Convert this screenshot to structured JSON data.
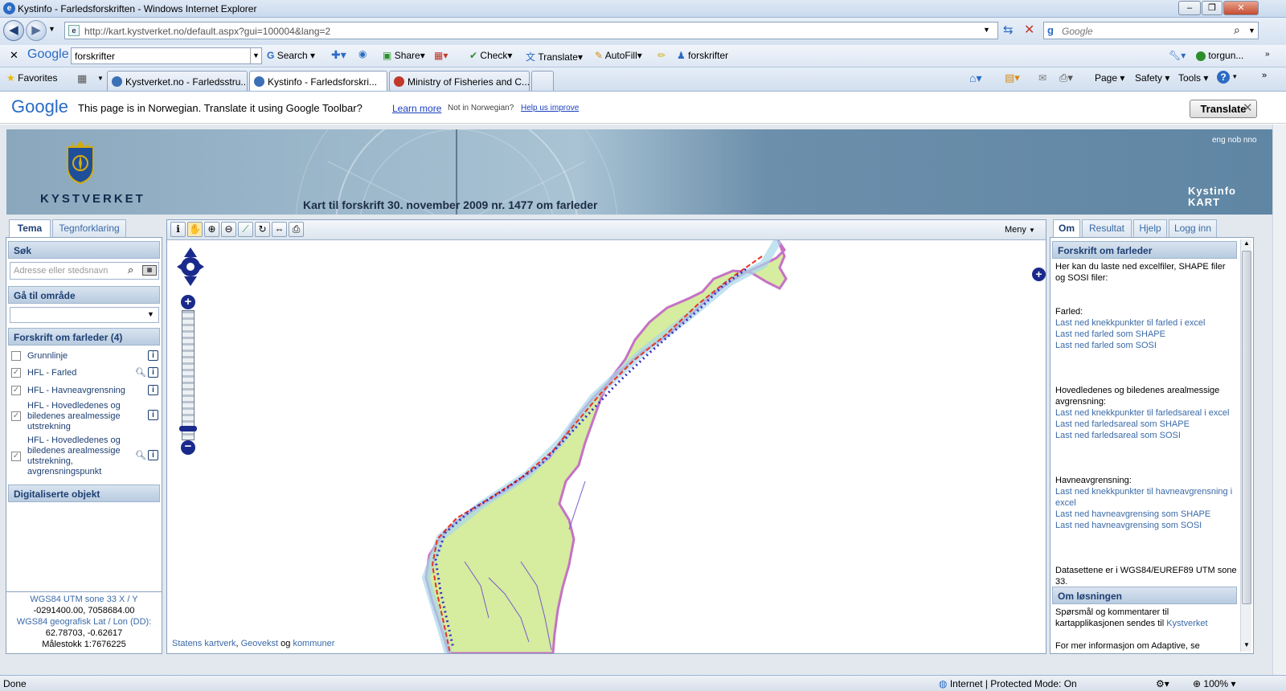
{
  "window": {
    "title": "Kystinfo - Farledsforskriften - Windows Internet Explorer"
  },
  "address": {
    "url": "http://kart.kystverket.no/default.aspx?gui=100004&lang=2",
    "search_placeholder": "Google"
  },
  "gtoolbar": {
    "logo": "Google",
    "query": "forskrifter",
    "search_label": "Search",
    "share_label": "Share",
    "check_label": "Check",
    "translate_label": "Translate",
    "autofill_label": "AutoFill",
    "highlight_term": "forskrifter",
    "account_label": "torgun..."
  },
  "favbar": {
    "favorites_label": "Favorites",
    "tabs": [
      {
        "label": "Kystverket.no - Farledsstru...",
        "color": "#3b6fb6"
      },
      {
        "label": "Kystinfo - Farledsforskri...",
        "color": "#3b6fb6"
      },
      {
        "label": "Ministry of Fisheries and C...",
        "color": "#c0392b"
      }
    ],
    "page_menu": "Page",
    "safety_menu": "Safety",
    "tools_menu": "Tools"
  },
  "translate": {
    "logo": "Google",
    "message": "This page is in Norwegian.  Translate it using Google Toolbar?",
    "learn_more": "Learn more",
    "not_norwegian": "Not in Norwegian?",
    "help_improve": "Help us improve",
    "button": "Translate"
  },
  "banner": {
    "brand": "KYSTVERKET",
    "subtitle": "Kart til forskrift 30. november 2009 nr. 1477 om farleder",
    "langs": "eng nob nno",
    "kart_logo_line1": "Kystinfo",
    "kart_logo_line2": "KART"
  },
  "left": {
    "tabs": [
      "Tema",
      "Tegnforklaring"
    ],
    "search_header": "Søk",
    "search_placeholder": "Adresse eller stedsnavn",
    "goto_header": "Gå til område",
    "layers_header": "Forskrift om farleder (4)",
    "layers": [
      {
        "label": "Grunnlinje",
        "checked": false
      },
      {
        "label": "HFL - Farled",
        "checked": true
      },
      {
        "label": "HFL - Havneavgrensning",
        "checked": true
      },
      {
        "label": "HFL - Hovedledenes og biledenes arealmessige utstrekning",
        "checked": true
      },
      {
        "label": "HFL - Hovedledenes og biledenes arealmessige utstrekning, avgrensningspunkt",
        "checked": true
      }
    ],
    "digital_header": "Digitaliserte objekt",
    "coords": {
      "utm_label": "WGS84 UTM sone 33 X / Y",
      "utm_value": "-0291400.00, 7058684.00",
      "geo_label": "WGS84 geografisk Lat / Lon (DD):",
      "geo_value": "62.78703, -0.62617",
      "scale": "Målestokk 1:7676225"
    }
  },
  "map": {
    "menu_label": "Meny",
    "credits": {
      "a": "Statens kartverk",
      "sep1": ", ",
      "b": "Geovekst",
      "sep2": " og ",
      "c": "kommuner"
    }
  },
  "right": {
    "tabs": [
      "Om",
      "Resultat",
      "Hjelp",
      "Logg inn"
    ],
    "header1": "Forskrift om farleder",
    "intro": "Her kan du laste ned excelfiler, SHAPE filer og SOSI filer:",
    "farled_title": "Farled:",
    "farled_links": [
      "Last ned knekkpunkter til farled i excel",
      "Last ned farled som SHAPE",
      "Last ned farled som SOSI"
    ],
    "hoved_title": "Hovedledenes og biledenes arealmessige avgrensning:",
    "hoved_links": [
      "Last ned knekkpunkter til farledsareal i excel",
      "Last ned farledsareal som SHAPE",
      "Last ned farledsareal som SOSI"
    ],
    "havn_title": "Havneavgrensning:",
    "havn_links": [
      "Last ned knekkpunkter til havneavgrensning i excel",
      "Last ned havneavgrensing som SHAPE",
      "Last ned havneavgrensing som SOSI"
    ],
    "datum": "Datasettene er i WGS84/EUREF89 UTM sone 33.",
    "header2": "Om løsningen",
    "contact": "Spørsmål og kommentarer til kartapplikasjonen sendes til",
    "contact_link": "Kystverket",
    "more": "For mer informasjon om Adaptive, se"
  },
  "status": {
    "left": "Done",
    "zone": "Internet | Protected Mode: On",
    "zoom": "100%"
  }
}
